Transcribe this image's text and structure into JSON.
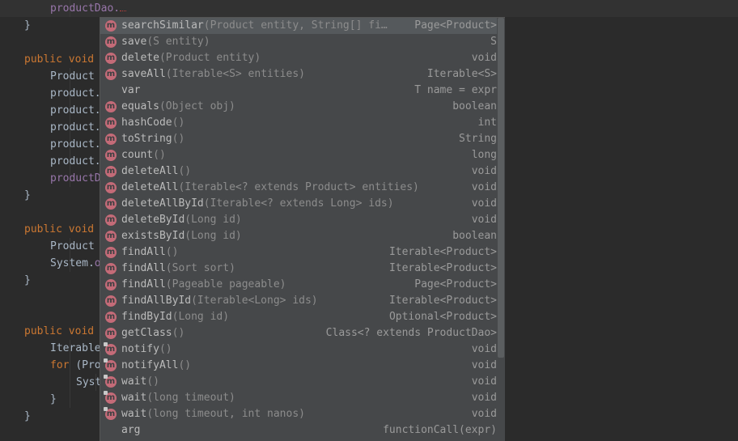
{
  "editor": {
    "lines": [
      {
        "indent": 2,
        "parts": [
          {
            "t": "productDao.",
            "c": "fld"
          }
        ],
        "squiggle": true,
        "row": 0
      },
      {
        "indent": 1,
        "parts": [
          {
            "t": "}",
            "c": ""
          }
        ],
        "row": 1
      },
      {
        "indent": 1,
        "parts": [
          {
            "t": "public void ",
            "c": "kw"
          }
        ],
        "row": 3
      },
      {
        "indent": 2,
        "parts": [
          {
            "t": "Product ",
            "c": ""
          }
        ],
        "row": 4
      },
      {
        "indent": 2,
        "parts": [
          {
            "t": "product.",
            "c": ""
          }
        ],
        "row": 5
      },
      {
        "indent": 2,
        "parts": [
          {
            "t": "product.",
            "c": ""
          }
        ],
        "row": 6
      },
      {
        "indent": 2,
        "parts": [
          {
            "t": "product.",
            "c": ""
          }
        ],
        "row": 7
      },
      {
        "indent": 2,
        "parts": [
          {
            "t": "product.",
            "c": ""
          }
        ],
        "row": 8
      },
      {
        "indent": 2,
        "parts": [
          {
            "t": "product.",
            "c": ""
          }
        ],
        "row": 9
      },
      {
        "indent": 2,
        "parts": [
          {
            "t": "productD",
            "c": "fld"
          }
        ],
        "row": 10
      },
      {
        "indent": 1,
        "parts": [
          {
            "t": "}",
            "c": ""
          }
        ],
        "row": 11
      },
      {
        "indent": 1,
        "parts": [
          {
            "t": "public void ",
            "c": "kw"
          }
        ],
        "row": 13
      },
      {
        "indent": 2,
        "parts": [
          {
            "t": "Product ",
            "c": ""
          }
        ],
        "row": 14
      },
      {
        "indent": 2,
        "parts": [
          {
            "t": "System.",
            "c": ""
          },
          {
            "t": "o",
            "c": "fld"
          }
        ],
        "row": 15
      },
      {
        "indent": 1,
        "parts": [
          {
            "t": "}",
            "c": ""
          }
        ],
        "row": 16
      },
      {
        "indent": 1,
        "parts": [
          {
            "t": "public void ",
            "c": "kw"
          }
        ],
        "row": 19
      },
      {
        "indent": 2,
        "parts": [
          {
            "t": "Iterable",
            "c": ""
          }
        ],
        "row": 20
      },
      {
        "indent": 2,
        "parts": [
          {
            "t": "for ",
            "c": "kw"
          },
          {
            "t": "(Pro",
            "c": ""
          }
        ],
        "row": 21
      },
      {
        "indent": 3,
        "parts": [
          {
            "t": "Syst",
            "c": ""
          }
        ],
        "row": 22
      },
      {
        "indent": 2,
        "parts": [
          {
            "t": "}",
            "c": ""
          }
        ],
        "row": 23
      },
      {
        "indent": 1,
        "parts": [
          {
            "t": "}",
            "c": ""
          }
        ],
        "row": 24
      }
    ]
  },
  "completion": {
    "selected_index": 0,
    "items": [
      {
        "name": "searchSimilar",
        "params": "(Product entity, String[] fi…",
        "type": "Page<Product>",
        "icon": "method-icon"
      },
      {
        "name": "save",
        "params": "(S entity)",
        "type": "S",
        "icon": "method-icon"
      },
      {
        "name": "delete",
        "params": "(Product entity)",
        "type": "void",
        "icon": "method-icon"
      },
      {
        "name": "saveAll",
        "params": "(Iterable<S> entities)",
        "type": "Iterable<S>",
        "icon": "method-icon"
      },
      {
        "name": "var",
        "params": "",
        "type": "T name = expr",
        "icon": ""
      },
      {
        "name": "equals",
        "params": "(Object obj)",
        "type": "boolean",
        "icon": "method-icon"
      },
      {
        "name": "hashCode",
        "params": "()",
        "type": "int",
        "icon": "method-icon"
      },
      {
        "name": "toString",
        "params": "()",
        "type": "String",
        "icon": "method-icon"
      },
      {
        "name": "count",
        "params": "()",
        "type": "long",
        "icon": "method-icon"
      },
      {
        "name": "deleteAll",
        "params": "()",
        "type": "void",
        "icon": "method-icon"
      },
      {
        "name": "deleteAll",
        "params": "(Iterable<? extends Product> entities)",
        "type": "void",
        "icon": "method-icon"
      },
      {
        "name": "deleteAllById",
        "params": "(Iterable<? extends Long> ids)",
        "type": "void",
        "icon": "method-icon"
      },
      {
        "name": "deleteById",
        "params": "(Long id)",
        "type": "void",
        "icon": "method-icon"
      },
      {
        "name": "existsById",
        "params": "(Long id)",
        "type": "boolean",
        "icon": "method-icon"
      },
      {
        "name": "findAll",
        "params": "()",
        "type": "Iterable<Product>",
        "icon": "method-icon"
      },
      {
        "name": "findAll",
        "params": "(Sort sort)",
        "type": "Iterable<Product>",
        "icon": "method-icon"
      },
      {
        "name": "findAll",
        "params": "(Pageable pageable)",
        "type": "Page<Product>",
        "icon": "method-icon"
      },
      {
        "name": "findAllById",
        "params": "(Iterable<Long> ids)",
        "type": "Iterable<Product>",
        "icon": "method-icon"
      },
      {
        "name": "findById",
        "params": "(Long id)",
        "type": "Optional<Product>",
        "icon": "method-icon"
      },
      {
        "name": "getClass",
        "params": "()",
        "type": "Class<? extends ProductDao>",
        "icon": "method-icon"
      },
      {
        "name": "notify",
        "params": "()",
        "type": "void",
        "icon": "final-method-icon"
      },
      {
        "name": "notifyAll",
        "params": "()",
        "type": "void",
        "icon": "final-method-icon"
      },
      {
        "name": "wait",
        "params": "()",
        "type": "void",
        "icon": "final-method-icon"
      },
      {
        "name": "wait",
        "params": "(long timeout)",
        "type": "void",
        "icon": "final-method-icon"
      },
      {
        "name": "wait",
        "params": "(long timeout, int nanos)",
        "type": "void",
        "icon": "final-method-icon"
      },
      {
        "name": "arg",
        "params": "",
        "type": "functionCall(expr)",
        "icon": ""
      }
    ],
    "icon_letter": "m"
  }
}
